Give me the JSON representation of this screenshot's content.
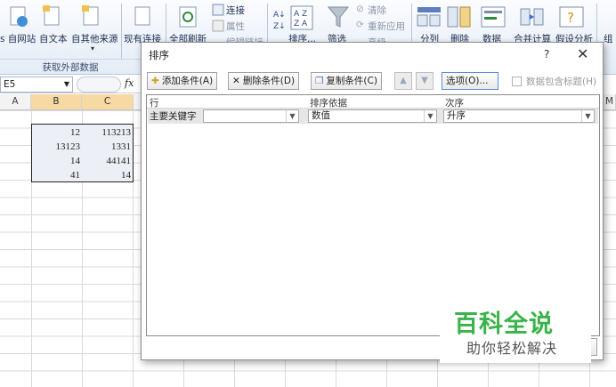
{
  "ribbon": {
    "from_web": "s 自网站",
    "from_text": "自文本",
    "from_other": "自其他来源",
    "existing_conn": "现有连接",
    "refresh_all": "全部刷新",
    "connections": "连接",
    "properties": "属性",
    "edit_links": "编辑链接",
    "sort": "排序...",
    "filter": "筛选",
    "clear": "清除",
    "reapply": "重新应用",
    "advanced": "高级",
    "text_to_columns": "分列",
    "remove_dup": "删除",
    "data_validation": "数据",
    "consolidate": "合并计算",
    "what_if": "假设分析",
    "group": "组",
    "group_label": "获取外部数据"
  },
  "namebox": {
    "value": "E5",
    "fx": "fx"
  },
  "columns": [
    "A",
    "B",
    "C",
    "M"
  ],
  "cells": [
    [
      "12",
      "113213"
    ],
    [
      "13123",
      "1331"
    ],
    [
      "14",
      "44141"
    ],
    [
      "41",
      "14"
    ]
  ],
  "dialog": {
    "title": "排序",
    "help": "?",
    "close": "✕",
    "add_level": "添加条件(A)",
    "delete_level": "删除条件(D)",
    "copy_level": "复制条件(C)",
    "options": "选项(O)...",
    "has_headers": "数据包含标题(H)",
    "col_header": "行",
    "sort_on_header": "排序依据",
    "order_header": "次序",
    "row_label": "主要关键字",
    "row_key": "",
    "sort_on": "数值",
    "order": "升序"
  },
  "watermark": {
    "title": "百科全说",
    "subtitle": "助你轻松解决"
  }
}
